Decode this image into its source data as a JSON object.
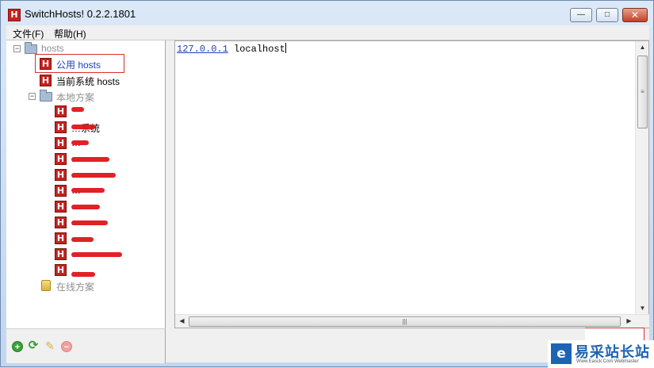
{
  "window": {
    "title": "SwitchHosts! 0.2.2.1801",
    "app_icon": "H",
    "controls": {
      "minimize": "—",
      "maximize": "□",
      "close": "✕"
    }
  },
  "menu": {
    "file": "文件(F)",
    "help": "帮助(H)"
  },
  "tree": {
    "root_label": "hosts",
    "common_hosts": "公用 hosts",
    "current_system_hosts": "当前系统 hosts",
    "local_plans_label": "本地方案",
    "online_plans_label": "在线方案",
    "local_items": [
      "",
      "…系统",
      "…",
      "…",
      "…",
      "…",
      "…",
      "…",
      "",
      "…",
      "…"
    ]
  },
  "toolbar": {
    "add_icon": "add-icon",
    "refresh_icon": "refresh-icon",
    "edit_icon": "edit-icon",
    "delete_icon": "delete-icon"
  },
  "editor": {
    "ip": "127.0.0.1",
    "host": "localhost"
  },
  "watermark": {
    "logo": "e",
    "title": "易采站长站",
    "subtitle": "Www.Easck.Com Webmaster"
  },
  "colors": {
    "accent_red": "#c5221f",
    "link_blue": "#1d3fbf",
    "selection_border": "#d9302c"
  }
}
